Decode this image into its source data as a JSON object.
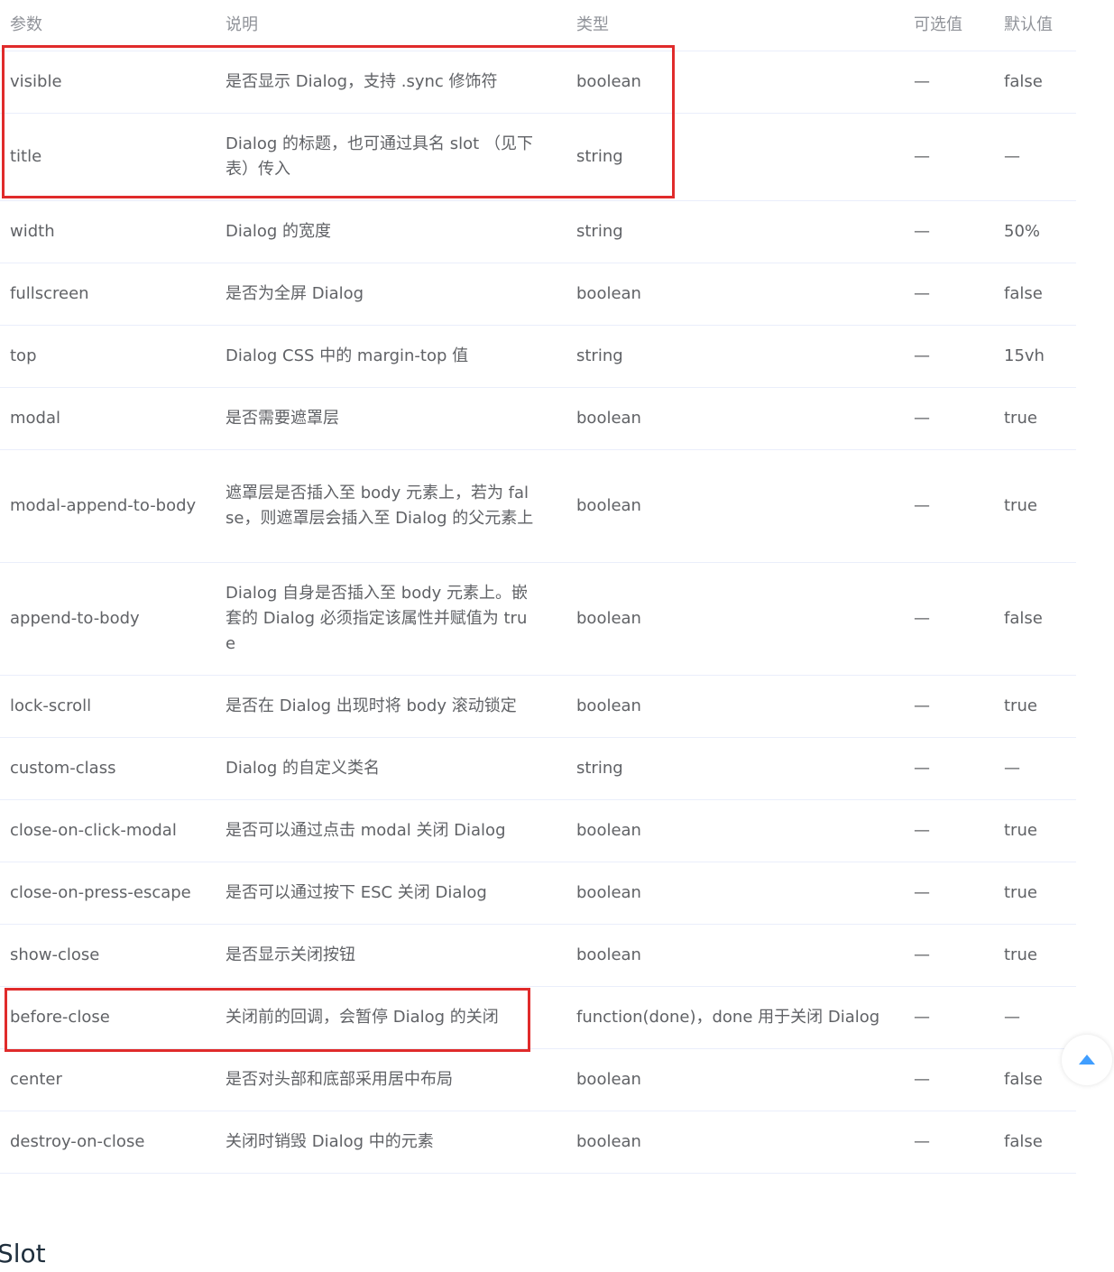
{
  "table": {
    "headers": {
      "param": "参数",
      "desc": "说明",
      "type": "类型",
      "options": "可选值",
      "default": "默认值"
    },
    "rows": [
      {
        "param": "visible",
        "desc": "是否显示 Dialog，支持 .sync 修饰符",
        "type": "boolean",
        "options": "—",
        "default": "false"
      },
      {
        "param": "title",
        "desc": "Dialog 的标题，也可通过具名 slot （见下表）传入",
        "type": "string",
        "options": "—",
        "default": "—"
      },
      {
        "param": "width",
        "desc": "Dialog 的宽度",
        "type": "string",
        "options": "—",
        "default": "50%"
      },
      {
        "param": "fullscreen",
        "desc": "是否为全屏 Dialog",
        "type": "boolean",
        "options": "—",
        "default": "false"
      },
      {
        "param": "top",
        "desc": "Dialog CSS 中的 margin-top 值",
        "type": "string",
        "options": "—",
        "default": "15vh"
      },
      {
        "param": "modal",
        "desc": "是否需要遮罩层",
        "type": "boolean",
        "options": "—",
        "default": "true"
      },
      {
        "param": "modal-append-to-body",
        "desc": "遮罩层是否插入至 body 元素上，若为 false，则遮罩层会插入至 Dialog 的父元素上",
        "type": "boolean",
        "options": "—",
        "default": "true"
      },
      {
        "param": "append-to-body",
        "desc": "Dialog 自身是否插入至 body 元素上。嵌套的 Dialog 必须指定该属性并赋值为 true",
        "type": "boolean",
        "options": "—",
        "default": "false"
      },
      {
        "param": "lock-scroll",
        "desc": "是否在 Dialog 出现时将 body 滚动锁定",
        "type": "boolean",
        "options": "—",
        "default": "true"
      },
      {
        "param": "custom-class",
        "desc": "Dialog 的自定义类名",
        "type": "string",
        "options": "—",
        "default": "—"
      },
      {
        "param": "close-on-click-modal",
        "desc": "是否可以通过点击 modal 关闭 Dialog",
        "type": "boolean",
        "options": "—",
        "default": "true"
      },
      {
        "param": "close-on-press-escape",
        "desc": "是否可以通过按下 ESC 关闭 Dialog",
        "type": "boolean",
        "options": "—",
        "default": "true"
      },
      {
        "param": "show-close",
        "desc": "是否显示关闭按钮",
        "type": "boolean",
        "options": "—",
        "default": "true"
      },
      {
        "param": "before-close",
        "desc": "关闭前的回调，会暂停 Dialog 的关闭",
        "type": "function(done)，done 用于关闭 Dialog",
        "options": "—",
        "default": "—"
      },
      {
        "param": "center",
        "desc": "是否对头部和底部采用居中布局",
        "type": "boolean",
        "options": "—",
        "default": "false"
      },
      {
        "param": "destroy-on-close",
        "desc": "关闭时销毁 Dialog 中的元素",
        "type": "boolean",
        "options": "—",
        "default": "false"
      }
    ]
  },
  "next_section": {
    "title": "Slot"
  },
  "colors": {
    "highlight_border": "#e02b2b",
    "accent": "#409eff",
    "row_divider": "#eaeefb"
  },
  "icons": {
    "back_to_top": "caret-up-icon"
  }
}
